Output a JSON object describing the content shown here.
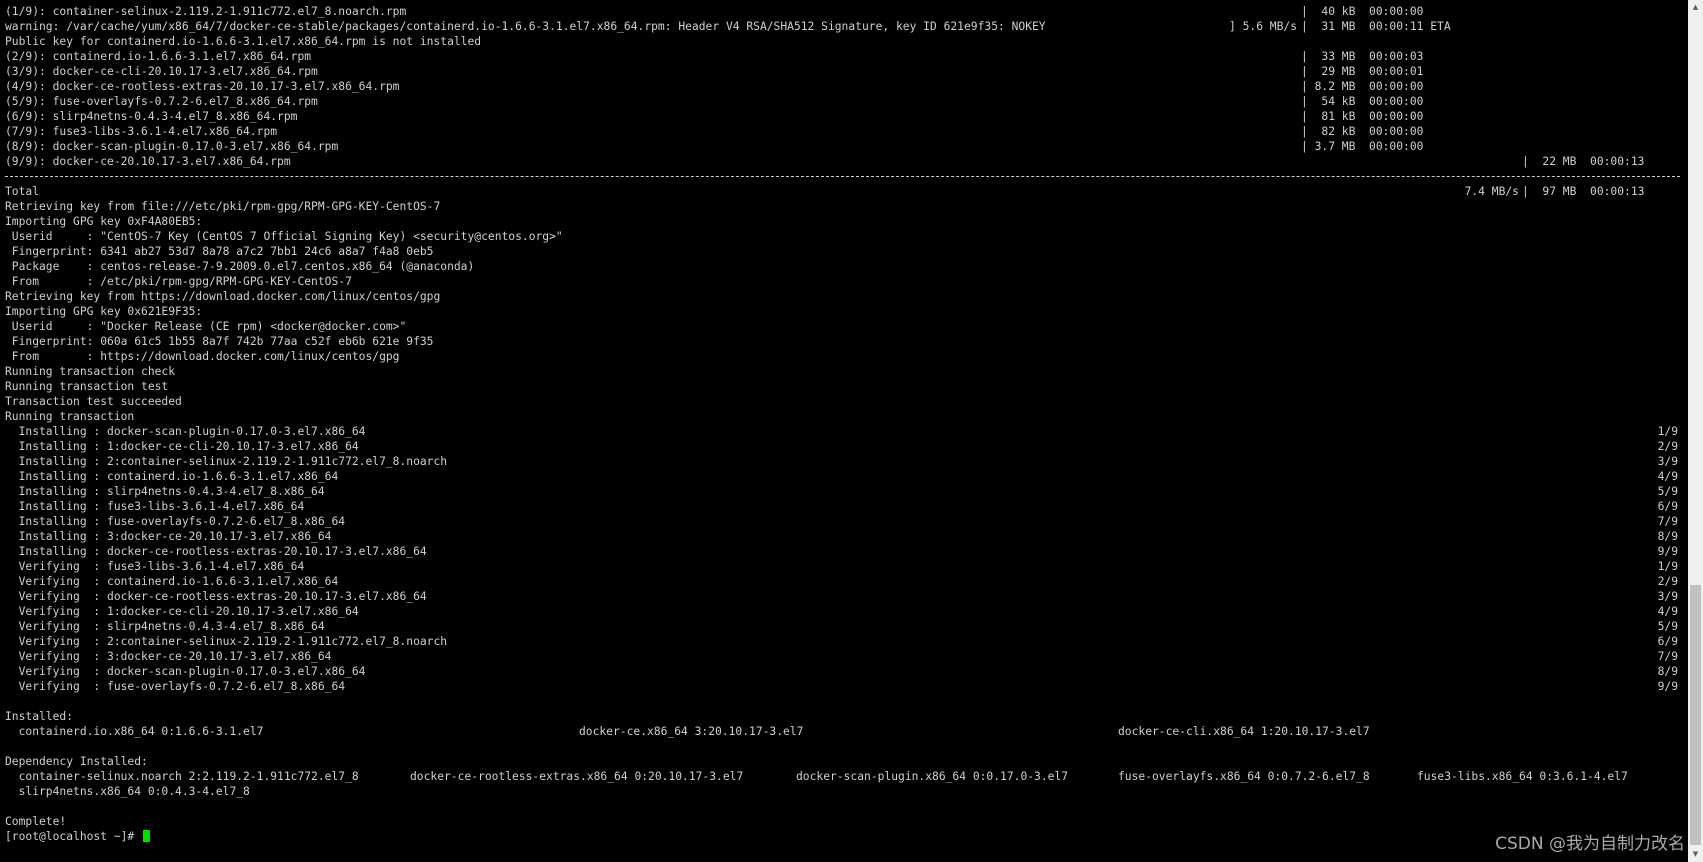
{
  "terminal": {
    "lines": [
      {
        "left": "(1/9): container-selinux-2.119.2-1.911c772.el7_8.noarch.rpm",
        "mid": "|  40 kB  00:00:00"
      },
      {
        "left": "warning: /var/cache/yum/x86_64/7/docker-ce-stable/packages/containerd.io-1.6.6-3.1.el7.x86_64.rpm: Header V4 RSA/SHA512 Signature, key ID 621e9f35: NOKEY",
        "progress": "] 5.6 MB/s",
        "mid": "|  31 MB  00:00:11 ETA"
      },
      {
        "left": "Public key for containerd.io-1.6.6-3.1.el7.x86_64.rpm is not installed"
      },
      {
        "left": "(2/9): containerd.io-1.6.6-3.1.el7.x86_64.rpm",
        "mid": "|  33 MB  00:00:03"
      },
      {
        "left": "(3/9): docker-ce-cli-20.10.17-3.el7.x86_64.rpm",
        "mid": "|  29 MB  00:00:01"
      },
      {
        "left": "(4/9): docker-ce-rootless-extras-20.10.17-3.el7.x86_64.rpm",
        "mid": "| 8.2 MB  00:00:00"
      },
      {
        "left": "(5/9): fuse-overlayfs-0.7.2-6.el7_8.x86_64.rpm",
        "mid": "|  54 kB  00:00:00"
      },
      {
        "left": "(6/9): slirp4netns-0.4.3-4.el7_8.x86_64.rpm",
        "mid": "|  81 kB  00:00:00"
      },
      {
        "left": "(7/9): fuse3-libs-3.6.1-4.el7.x86_64.rpm",
        "mid": "|  82 kB  00:00:00"
      },
      {
        "left": "(8/9): docker-scan-plugin-0.17.0-3.el7.x86_64.rpm",
        "mid": "| 3.7 MB  00:00:00"
      },
      {
        "left": "(9/9): docker-ce-20.10.17-3.el7.x86_64.rpm",
        "far": "|  22 MB  00:00:13"
      },
      {
        "rule": true
      },
      {
        "left": "Total",
        "total_rate": "7.4 MB/s",
        "far": "|  97 MB  00:00:13"
      },
      {
        "left": "Retrieving key from file:///etc/pki/rpm-gpg/RPM-GPG-KEY-CentOS-7"
      },
      {
        "left": "Importing GPG key 0xF4A80EB5:"
      },
      {
        "left": " Userid     : \"CentOS-7 Key (CentOS 7 Official Signing Key) <security@centos.org>\""
      },
      {
        "left": " Fingerprint: 6341 ab27 53d7 8a78 a7c2 7bb1 24c6 a8a7 f4a8 0eb5"
      },
      {
        "left": " Package    : centos-release-7-9.2009.0.el7.centos.x86_64 (@anaconda)"
      },
      {
        "left": " From       : /etc/pki/rpm-gpg/RPM-GPG-KEY-CentOS-7"
      },
      {
        "left": "Retrieving key from https://download.docker.com/linux/centos/gpg"
      },
      {
        "left": "Importing GPG key 0x621E9F35:"
      },
      {
        "left": " Userid     : \"Docker Release (CE rpm) <docker@docker.com>\""
      },
      {
        "left": " Fingerprint: 060a 61c5 1b55 8a7f 742b 77aa c52f eb6b 621e 9f35"
      },
      {
        "left": " From       : https://download.docker.com/linux/centos/gpg"
      },
      {
        "left": "Running transaction check"
      },
      {
        "left": "Running transaction test"
      },
      {
        "left": "Transaction test succeeded"
      },
      {
        "left": "Running transaction"
      },
      {
        "left": "  Installing : docker-scan-plugin-0.17.0-3.el7.x86_64",
        "count": "1/9"
      },
      {
        "left": "  Installing : 1:docker-ce-cli-20.10.17-3.el7.x86_64",
        "count": "2/9"
      },
      {
        "left": "  Installing : 2:container-selinux-2.119.2-1.911c772.el7_8.noarch",
        "count": "3/9"
      },
      {
        "left": "  Installing : containerd.io-1.6.6-3.1.el7.x86_64",
        "count": "4/9"
      },
      {
        "left": "  Installing : slirp4netns-0.4.3-4.el7_8.x86_64",
        "count": "5/9"
      },
      {
        "left": "  Installing : fuse3-libs-3.6.1-4.el7.x86_64",
        "count": "6/9"
      },
      {
        "left": "  Installing : fuse-overlayfs-0.7.2-6.el7_8.x86_64",
        "count": "7/9"
      },
      {
        "left": "  Installing : 3:docker-ce-20.10.17-3.el7.x86_64",
        "count": "8/9"
      },
      {
        "left": "  Installing : docker-ce-rootless-extras-20.10.17-3.el7.x86_64",
        "count": "9/9"
      },
      {
        "left": "  Verifying  : fuse3-libs-3.6.1-4.el7.x86_64",
        "count": "1/9"
      },
      {
        "left": "  Verifying  : containerd.io-1.6.6-3.1.el7.x86_64",
        "count": "2/9"
      },
      {
        "left": "  Verifying  : docker-ce-rootless-extras-20.10.17-3.el7.x86_64",
        "count": "3/9"
      },
      {
        "left": "  Verifying  : 1:docker-ce-cli-20.10.17-3.el7.x86_64",
        "count": "4/9"
      },
      {
        "left": "  Verifying  : slirp4netns-0.4.3-4.el7_8.x86_64",
        "count": "5/9"
      },
      {
        "left": "  Verifying  : 2:container-selinux-2.119.2-1.911c772.el7_8.noarch",
        "count": "6/9"
      },
      {
        "left": "  Verifying  : 3:docker-ce-20.10.17-3.el7.x86_64",
        "count": "7/9"
      },
      {
        "left": "  Verifying  : docker-scan-plugin-0.17.0-3.el7.x86_64",
        "count": "8/9"
      },
      {
        "left": "  Verifying  : fuse-overlayfs-0.7.2-6.el7_8.x86_64",
        "count": "9/9"
      },
      {
        "left": ""
      },
      {
        "left": "Installed:"
      },
      {
        "cols3": [
          "  containerd.io.x86_64 0:1.6.6-3.1.el7",
          "docker-ce.x86_64 3:20.10.17-3.el7",
          "docker-ce-cli.x86_64 1:20.10.17-3.el7"
        ]
      },
      {
        "left": ""
      },
      {
        "left": "Dependency Installed:"
      },
      {
        "cols5": [
          "  container-selinux.noarch 2:2.119.2-1.911c772.el7_8",
          "docker-ce-rootless-extras.x86_64 0:20.10.17-3.el7",
          "docker-scan-plugin.x86_64 0:0.17.0-3.el7",
          "fuse-overlayfs.x86_64 0:0.7.2-6.el7_8",
          "fuse3-libs.x86_64 0:3.6.1-4.el7"
        ]
      },
      {
        "left": "  slirp4netns.x86_64 0:0.4.3-4.el7_8"
      },
      {
        "left": ""
      },
      {
        "left": "Complete!"
      },
      {
        "left": "[root@localhost ~]# ",
        "prompt": true
      }
    ]
  },
  "watermark": "CSDN @我为自制力改名"
}
